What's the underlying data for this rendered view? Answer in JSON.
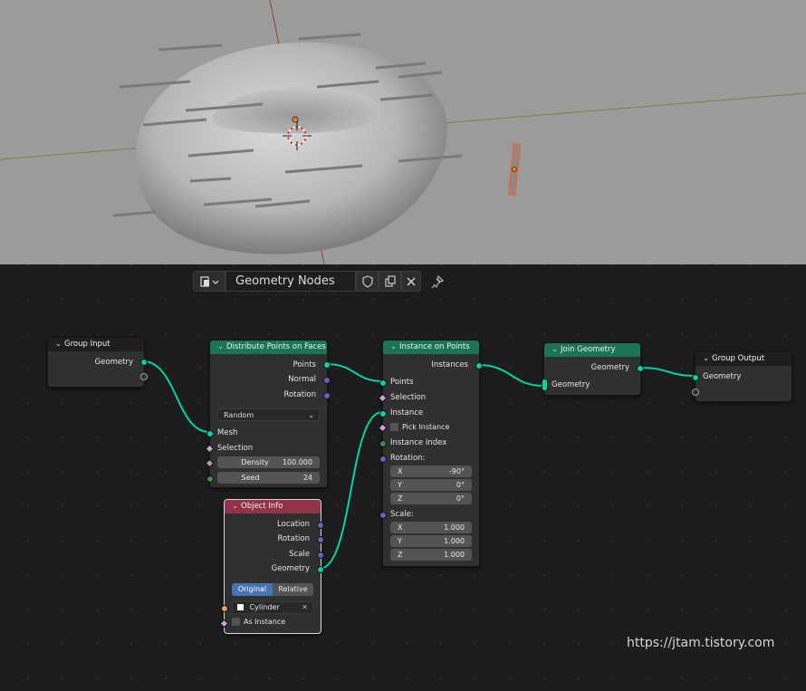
{
  "header": {
    "tree_name": "Geometry Nodes",
    "editor_type_icon": "node-editor-icon",
    "shield_icon": "fake-user-shield-icon",
    "copy_icon": "duplicate-icon",
    "close_icon": "close-icon",
    "pin_icon": "pin-icon"
  },
  "nodes": {
    "group_input": {
      "title": "Group Input",
      "out_geometry": "Geometry"
    },
    "distribute": {
      "title": "Distribute Points on Faces",
      "out_points": "Points",
      "out_normal": "Normal",
      "out_rotation": "Rotation",
      "mode": "Random",
      "in_mesh": "Mesh",
      "in_selection": "Selection",
      "density_label": "Density",
      "density_value": "100.000",
      "seed_label": "Seed",
      "seed_value": "24"
    },
    "object_info": {
      "title": "Object Info",
      "out_location": "Location",
      "out_rotation": "Rotation",
      "out_scale": "Scale",
      "out_geometry": "Geometry",
      "btn_original": "Original",
      "btn_relative": "Relative",
      "object": "Cylinder",
      "as_instance": "As Instance"
    },
    "instance_on_points": {
      "title": "Instance on Points",
      "out_instances": "Instances",
      "in_points": "Points",
      "in_selection": "Selection",
      "in_instance": "Instance",
      "pick_instance": "Pick Instance",
      "instance_index": "Instance Index",
      "rotation_label": "Rotation:",
      "rot_x_label": "X",
      "rot_x": "-90°",
      "rot_y_label": "Y",
      "rot_y": "0°",
      "rot_z_label": "Z",
      "rot_z": "0°",
      "scale_label": "Scale:",
      "scale_x_label": "X",
      "scale_x": "1.000",
      "scale_y_label": "Y",
      "scale_y": "1.000",
      "scale_z_label": "Z",
      "scale_z": "1.000"
    },
    "join_geometry": {
      "title": "Join Geometry",
      "out_geometry": "Geometry",
      "in_geometry": "Geometry"
    },
    "group_output": {
      "title": "Group Output",
      "in_geometry": "Geometry"
    }
  },
  "colors": {
    "geometry_wire": "#00d6a3",
    "header_green": "#1b7456",
    "header_red": "#93334b",
    "selected_object": "#e8662a"
  },
  "watermark": "https://jtam.tistory.com"
}
